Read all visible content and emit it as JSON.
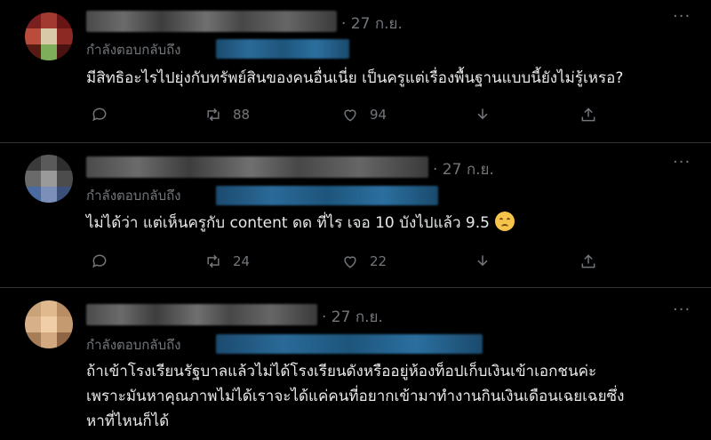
{
  "tweets": [
    {
      "time": "· 27 ก.ย.",
      "reply_label": "กำลังตอบกลับถึง",
      "text_lines": [
        "มีสิทธิอะไรไปยุ่งกับทรัพย์สินของคนอื่นเนี่ย เป็นครูแต่เรื่องพื้นฐานแบบนี้ยังไม่รู้เหรอ?"
      ],
      "retweets": "88",
      "likes": "94"
    },
    {
      "time": "· 27 ก.ย.",
      "reply_label": "กำลังตอบกลับถึง",
      "text_lines": [
        "ไม่ได้ว่า แต่เห็นครูกับ content ดด ที่ไร เจอ 10 บังไปแล้ว 9.5"
      ],
      "retweets": "24",
      "likes": "22"
    },
    {
      "time": "· 27 ก.ย.",
      "reply_label": "กำลังตอบกลับถึง",
      "text_lines": [
        "ถ้าเข้าโรงเรียนรัฐบาลแล้วไม่ได้โรงเรียนดังหรืออยู่ห้องท็อปเก็บเงินเข้าเอกชนค่ะ",
        "เพราะมันหาคุณภาพไม่ได้เราจะได้แค่คนที่อยากเข้ามาทำงานกินเงินเดือนเฉยเฉยซึ่ง",
        "หาที่ไหนก็ได้"
      ]
    }
  ],
  "icons": {
    "more": "more-dots-icon",
    "reply": "reply-icon",
    "retweet": "retweet-icon",
    "like": "heart-icon",
    "bookmark": "download-icon",
    "share": "share-icon",
    "emoji": "worried-face-emoji"
  }
}
